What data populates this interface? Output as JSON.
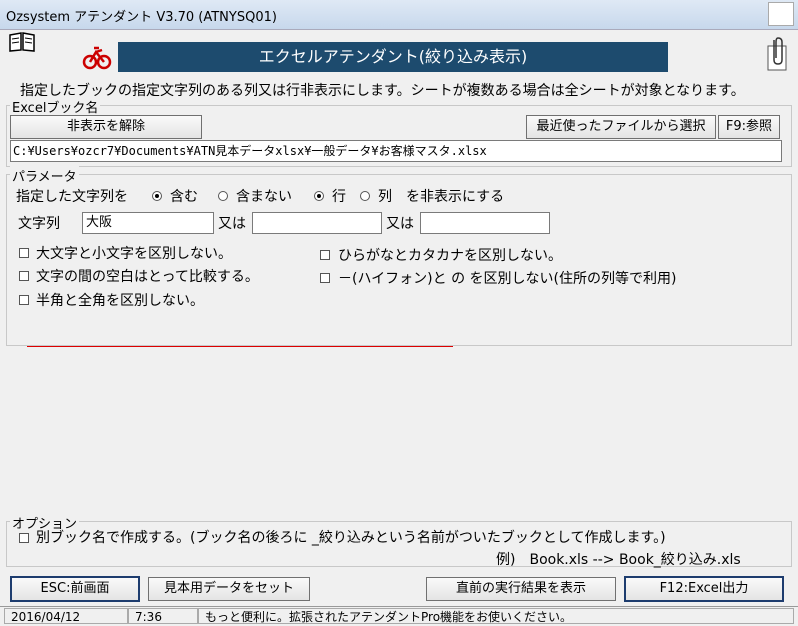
{
  "window": {
    "title": "Ozsystem アテンダント V3.70 (ATNYSQ01)"
  },
  "banner": {
    "title": "エクセルアテンダント(絞り込み表示)"
  },
  "description": "指定したブックの指定文字列のある列又は行非表示にします。シートが複数ある場合は全シートが対象となります。",
  "excel_group": {
    "label": "Excelブック名",
    "unhide_button": "非表示を解除",
    "recent_button": "最近使ったファイルから選択",
    "browse_button": "F9:参照",
    "path": "C:¥Users¥ozcr7¥Documents¥ATN見本データxlsx¥一般データ¥お客様マスタ.xlsx"
  },
  "params_group": {
    "label": "パラメータ",
    "specified_label": "指定した文字列を",
    "include": "含む",
    "exclude": "含まない",
    "row": "行",
    "col": "列",
    "hide_suffix": "を非表示にする",
    "string_label": "文字列",
    "or1": "又は",
    "or2": "又は",
    "value1": "大阪",
    "value2": "",
    "value3": "",
    "opt_case": "大文字と小文字を区別しない。",
    "opt_space": "文字の間の空白はとって比較する。",
    "opt_width": "半角と全角を区別しない。",
    "opt_kana": "ひらがなとカタカナを区別しない。",
    "opt_hyphen": "－(ハイフォン)と の を区別しない(住所の列等で利用)"
  },
  "option_group": {
    "label": "オプション",
    "separate_book": "別ブック名で作成する。(ブック名の後ろに _絞り込みという名前がついたブックとして作成します。)",
    "example": "例)　Book.xls --> Book_絞り込み.xls"
  },
  "buttons": {
    "esc": "ESC:前画面",
    "sample": "見本用データをセット",
    "last_result": "直前の実行結果を表示",
    "excel_out": "F12:Excel出力"
  },
  "status": {
    "date": "2016/04/12",
    "time": "7:36",
    "message": "もっと便利に。拡張されたアテンダントPro機能をお使いください。"
  }
}
